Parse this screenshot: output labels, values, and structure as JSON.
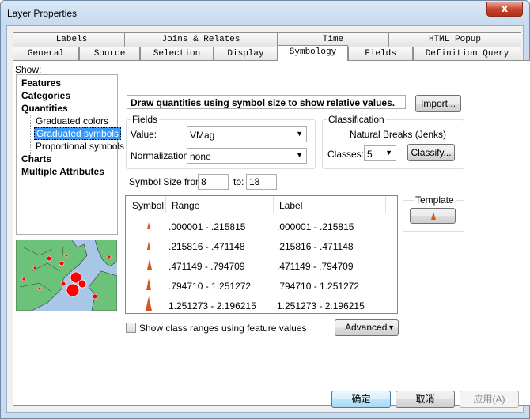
{
  "window": {
    "title": "Layer Properties",
    "close_label": "x"
  },
  "tabs_row1": [
    {
      "label": "Labels"
    },
    {
      "label": "Joins & Relates"
    },
    {
      "label": "Time"
    },
    {
      "label": "HTML Popup"
    }
  ],
  "tabs_row2": [
    {
      "label": "General"
    },
    {
      "label": "Source"
    },
    {
      "label": "Selection"
    },
    {
      "label": "Display"
    },
    {
      "label": "Symbology",
      "active": true
    },
    {
      "label": "Fields"
    },
    {
      "label": "Definition Query"
    }
  ],
  "show": {
    "label": "Show:",
    "items": [
      {
        "label": "Features",
        "bold": true
      },
      {
        "label": "Categories",
        "bold": true
      },
      {
        "label": "Quantities",
        "bold": true
      },
      {
        "label": "Graduated colors",
        "child": true
      },
      {
        "label": "Graduated symbols",
        "child": true,
        "selected": true
      },
      {
        "label": "Proportional symbols",
        "child": true
      },
      {
        "label": "Charts",
        "bold": true
      },
      {
        "label": "Multiple Attributes",
        "bold": true
      }
    ]
  },
  "main": {
    "description": "Draw quantities using symbol size to show relative values.",
    "import_label": "Import..."
  },
  "fields": {
    "title": "Fields",
    "value_label": "Value:",
    "value": "VMag",
    "normalization_label": "Normalization:",
    "normalization": "none"
  },
  "classification": {
    "title": "Classification",
    "method": "Natural Breaks (Jenks)",
    "classes_label": "Classes:",
    "classes": "5",
    "classify_label": "Classify..."
  },
  "symbol_size": {
    "from_label": "Symbol Size from:",
    "from": "8",
    "to_label": "to:",
    "to": "18"
  },
  "template": {
    "title": "Template"
  },
  "table": {
    "headers": [
      "Symbol",
      "Range",
      "Label"
    ],
    "rows": [
      {
        "range": ".000001 - .215815",
        "label": ".000001 - .215815"
      },
      {
        "range": ".215816 - .471148",
        "label": ".215816 - .471148"
      },
      {
        "range": ".471149 - .794709",
        "label": ".471149 - .794709"
      },
      {
        "range": ".794710 - 1.251272",
        "label": ".794710 - 1.251272"
      },
      {
        "range": "1.251273 - 2.196215",
        "label": "1.251273 - 2.196215"
      }
    ]
  },
  "options": {
    "show_ranges_label": "Show class ranges using feature values",
    "advanced_label": "Advanced"
  },
  "footer": {
    "ok_label": "确定",
    "cancel_label": "取消",
    "apply_label": "应用(A)"
  },
  "colors": {
    "symbol": "#d9541a",
    "selection": "#3399ff",
    "map_land": "#6dc27a",
    "map_water": "#a8c6e6",
    "map_point": "#ff0000"
  }
}
